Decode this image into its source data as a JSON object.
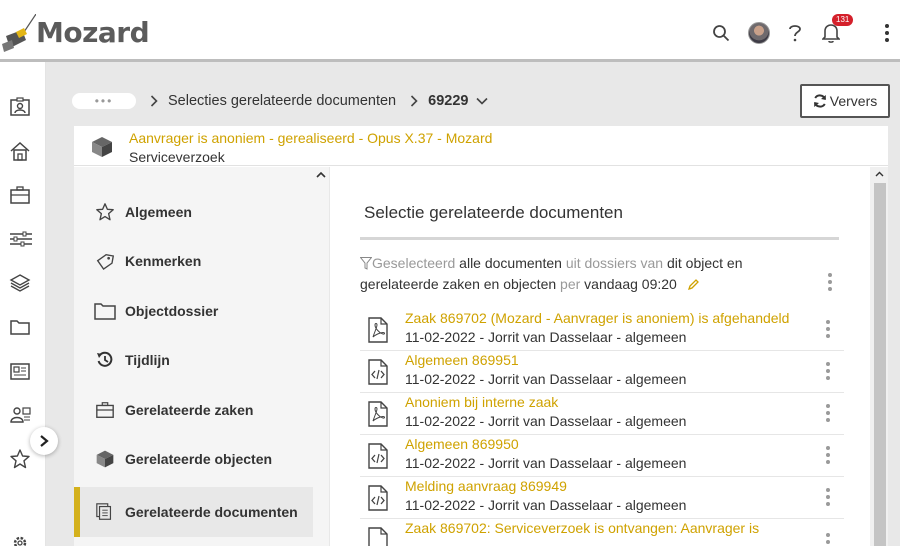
{
  "app": {
    "logo_text": "Mozard",
    "notification_count": "131"
  },
  "breadcrumb": {
    "dots": "•••",
    "items": [
      "Selecties gerelateerde documenten",
      "69229"
    ]
  },
  "toolbar": {
    "refresh_label": "Ververs"
  },
  "case": {
    "title": "Aanvrager is anoniem - gerealiseerd - Opus X.37 - Mozard",
    "subtitle": "Serviceverzoek"
  },
  "sidenav": {
    "items": [
      {
        "label": "Algemeen",
        "icon": "star-icon"
      },
      {
        "label": "Kenmerken",
        "icon": "tag-icon"
      },
      {
        "label": "Objectdossier",
        "icon": "folder-icon"
      },
      {
        "label": "Tijdlijn",
        "icon": "history-icon"
      },
      {
        "label": "Gerelateerde zaken",
        "icon": "briefcase-icon"
      },
      {
        "label": "Gerelateerde objecten",
        "icon": "cube-icon"
      },
      {
        "label": "Gerelateerde documenten",
        "icon": "documents-icon"
      }
    ]
  },
  "panel": {
    "title": "Selectie gerelateerde documenten",
    "filter": {
      "part1": "Geselecteerd",
      "part2": "alle documenten",
      "part3": "uit dossiers van",
      "part4": "dit object en gerelateerde zaken en objecten",
      "part5": "per",
      "part6": "vandaag 09:20"
    },
    "documents": [
      {
        "title": "Zaak 869702 (Mozard - Aanvrager is anoniem) is afgehandeld",
        "meta": "11-02-2022 - Jorrit van Dasselaar - algemeen",
        "type": "pdf"
      },
      {
        "title": "Algemeen 869951",
        "meta": "11-02-2022 - Jorrit van Dasselaar - algemeen",
        "type": "code"
      },
      {
        "title": "Anoniem bij interne zaak",
        "meta": "11-02-2022 - Jorrit van Dasselaar - algemeen",
        "type": "pdf"
      },
      {
        "title": "Algemeen 869950",
        "meta": "11-02-2022 - Jorrit van Dasselaar - algemeen",
        "type": "code"
      },
      {
        "title": "Melding aanvraag 869949",
        "meta": "11-02-2022 - Jorrit van Dasselaar - algemeen",
        "type": "code"
      },
      {
        "title": "Zaak 869702: Serviceverzoek is ontvangen: Aanvrager is",
        "meta": "",
        "type": "pdf"
      }
    ]
  },
  "colors": {
    "accent": "#cfa200",
    "logo": "#e3b616",
    "badge": "#d4202b"
  }
}
